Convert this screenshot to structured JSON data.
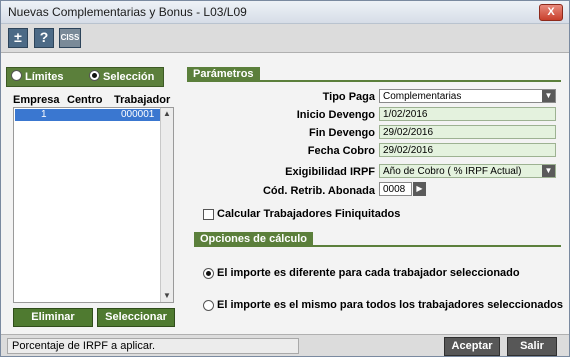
{
  "window": {
    "title": "Nuevas Complementarias y Bonus - L03/L09",
    "close_glyph": "X"
  },
  "toolbar": {
    "buttons": [
      "±",
      "?",
      "CISS"
    ]
  },
  "left": {
    "radios": [
      {
        "label": "Límites",
        "selected": false
      },
      {
        "label": "Selección",
        "selected": true
      }
    ],
    "columns": [
      "Empresa",
      "Centro",
      "Trabajador"
    ],
    "rows": [
      {
        "empresa": "1",
        "centro": "",
        "trabajador": "000001"
      }
    ],
    "buttons": {
      "eliminar": "Eliminar",
      "seleccionar": "Seleccionar"
    }
  },
  "parametros": {
    "title": "Parámetros",
    "tipo_paga": {
      "label": "Tipo Paga",
      "value": "Complementarias"
    },
    "inicio_devengo": {
      "label": "Inicio Devengo",
      "value": "1/02/2016"
    },
    "fin_devengo": {
      "label": "Fin Devengo",
      "value": "29/02/2016"
    },
    "fecha_cobro": {
      "label": "Fecha Cobro",
      "value": "29/02/2016"
    },
    "exigibilidad": {
      "label": "Exigibilidad IRPF",
      "value": "Año de Cobro ( % IRPF Actual)"
    },
    "cod_retrib": {
      "label": "Cód. Retrib. Abonada",
      "value": "0008"
    },
    "calcular_finiquitados": {
      "label": "Calcular Trabajadores Finiquitados",
      "checked": false
    }
  },
  "opciones": {
    "title": "Opciones de cálculo",
    "options": [
      {
        "label": "El importe es diferente para cada trabajador seleccionado",
        "selected": true
      },
      {
        "label": "El importe es el mismo para todos los trabajadores seleccionados",
        "selected": false
      }
    ]
  },
  "status": {
    "text": "Porcentaje de IRPF a aplicar.",
    "aceptar": "Aceptar",
    "salir": "Salir"
  },
  "colors": {
    "accent_green": "#5b7f3b",
    "selection_blue": "#3a77d0",
    "field_green": "#e4f2de"
  }
}
